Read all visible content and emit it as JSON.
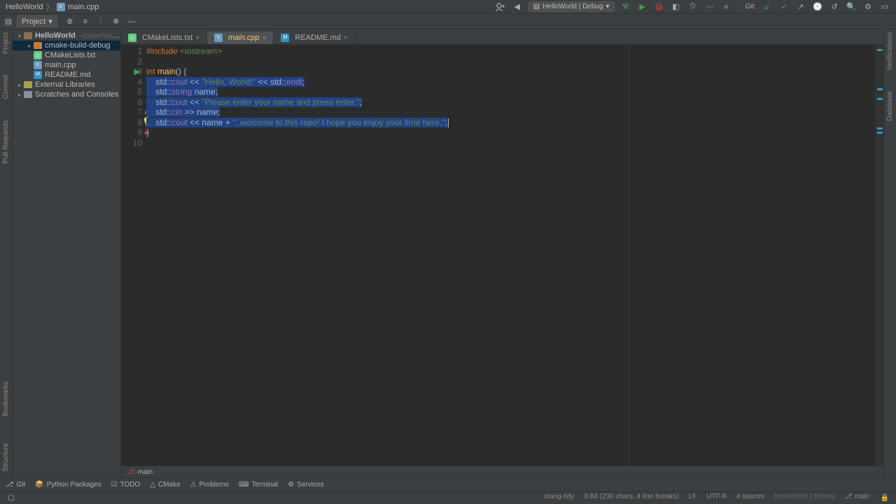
{
  "breadcrumb": {
    "project": "HelloWorld",
    "file": "main.cpp"
  },
  "runConfig": {
    "label": "HelloWorld | Debug"
  },
  "toolbar": {
    "projectLabel": "Project"
  },
  "tree": {
    "root": "HelloWorld",
    "rootHint": "~/CLionProjects/He",
    "buildDir": "cmake-build-debug",
    "cmake": "CMakeLists.txt",
    "main": "main.cpp",
    "readme": "README.md",
    "extLibs": "External Libraries",
    "scratches": "Scratches and Consoles"
  },
  "tabs": [
    {
      "name": "CMakeLists.txt",
      "active": false
    },
    {
      "name": "main.cpp",
      "active": true
    },
    {
      "name": "README.md",
      "active": false
    }
  ],
  "code": {
    "lines": [
      "1",
      "2",
      "3",
      "4",
      "5",
      "6",
      "7",
      "8",
      "9",
      "10"
    ],
    "l1_pp": "#include",
    "l1_inc": "<iostream>",
    "l3_kw": "int",
    "l3_fn": " main",
    "l3_rest": "() {",
    "l4_pre": "    std::",
    "l4_cout": "cout",
    "l4_op": " << ",
    "l4_str": "\"Hello, World!\"",
    "l4_op2": " << std::",
    "l4_endl": "endl",
    "l4_end": ";",
    "l5_pre": "    std::",
    "l5_str": "string",
    "l5_rest": " name;",
    "l6_pre": "    std::",
    "l6_cout": "cout",
    "l6_op": " << ",
    "l6_str": "\"Please enter your name and press enter.\"",
    "l6_end": ";",
    "l7_pre": "    std::",
    "l7_cin": "cin",
    "l7_rest": " >> name;",
    "l8_pre": "    std::",
    "l8_cout": "cout",
    "l8_op": " << name + ",
    "l8_str": "\", welcome to this repo! I hope you enjoy your time here.\"",
    "l8_end": ";",
    "l9": "}"
  },
  "branch": "main",
  "bottom": {
    "git": "Git",
    "pypkg": "Python Packages",
    "todo": "TODO",
    "cmake": "CMake",
    "problems": "Problems",
    "terminal": "Terminal",
    "services": "Services"
  },
  "status": {
    "analyzer": "clang-tidy",
    "pos": "8:84 (230 chars, 4 line breaks)",
    "lineEnd": "LF",
    "encoding": "UTF-8",
    "indent": "4 spaces",
    "context": "HelloWorld | Debug",
    "branch": "main"
  }
}
